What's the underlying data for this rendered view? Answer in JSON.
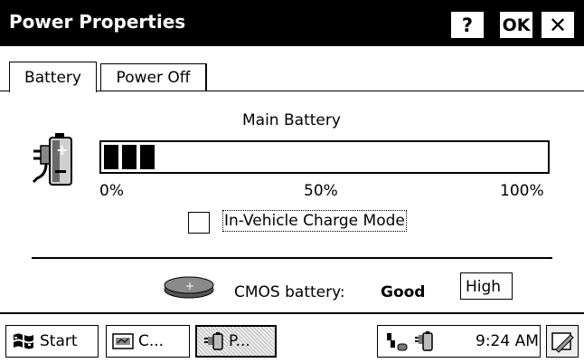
{
  "window": {
    "title": "Power Properties",
    "help_label": "?",
    "ok_label": "OK",
    "close_label": "✕"
  },
  "tabs": [
    {
      "label": "Battery",
      "selected": true
    },
    {
      "label": "Power Off",
      "selected": false
    }
  ],
  "battery": {
    "label": "Main Battery",
    "level_percent": 14,
    "scale": [
      "0%",
      "50%",
      "100%"
    ]
  },
  "in_vehicle": {
    "label": "In-Vehicle Charge Mode",
    "checked": false
  },
  "cmos": {
    "label": "CMOS battery:",
    "status": "Good",
    "level": "High"
  },
  "taskbar": {
    "start_label": "Start",
    "tasks": [
      "C...",
      "P..."
    ],
    "clock": "9:24 AM"
  },
  "icons": {
    "battery": "battery-plug-icon",
    "cmos": "cmos-battery-icon",
    "start": "windows-flag-icon",
    "desktop": "show-desktop-icon"
  }
}
